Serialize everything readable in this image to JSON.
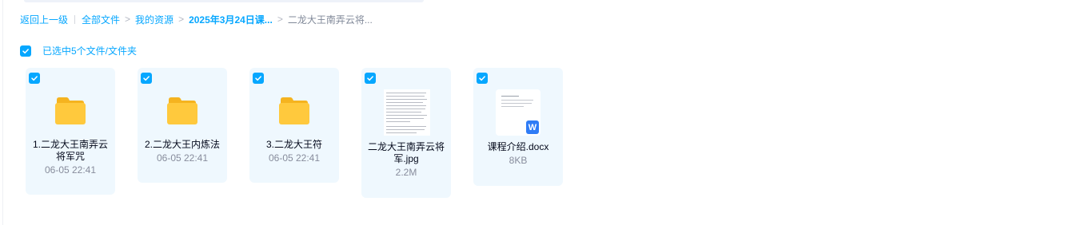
{
  "breadcrumb": {
    "back": "返回上一级",
    "items": [
      "全部文件",
      "我的资源",
      "2025年3月24日课...",
      "二龙大王南弄云将..."
    ]
  },
  "selection": {
    "text": "已选中5个文件/文件夹",
    "all_checked": true
  },
  "items": [
    {
      "name": "1.二龙大王南弄云将军咒",
      "meta": "06-05 22:41",
      "type": "folder",
      "checked": true,
      "icon": "folder-icon"
    },
    {
      "name": "2.二龙大王内炼法",
      "meta": "06-05 22:41",
      "type": "folder",
      "checked": true,
      "icon": "folder-icon"
    },
    {
      "name": "3.二龙大王符",
      "meta": "06-05 22:41",
      "type": "folder",
      "checked": true,
      "icon": "folder-icon"
    },
    {
      "name": "二龙大王南弄云将军.jpg",
      "meta": "2.2M",
      "type": "image",
      "checked": true,
      "icon": "image-thumbnail"
    },
    {
      "name": "课程介绍.docx",
      "meta": "8KB",
      "type": "doc",
      "checked": true,
      "icon": "word-doc-icon",
      "badge": "W"
    }
  ],
  "colors": {
    "accent": "#06a7ff",
    "card_bg": "#eff8fe",
    "folder": "#ffc93d",
    "word": "#2f7cf6"
  }
}
